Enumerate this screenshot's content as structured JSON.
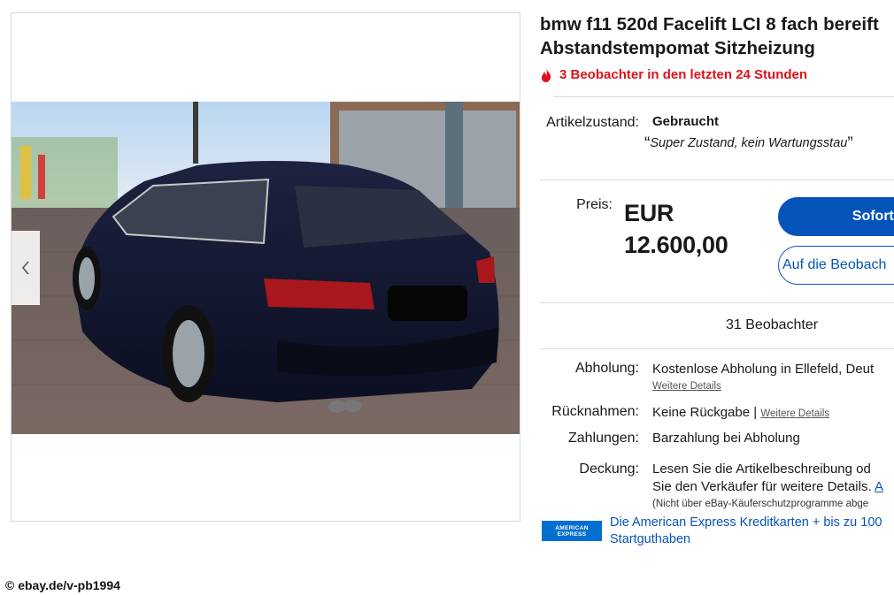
{
  "listing": {
    "title": "bmw f11 520d Facelift LCI 8 fach bereift Abstandstempomat Sitzheizung",
    "hot_watchers": "3 Beobachter in den letzten 24 Stunden",
    "condition_label": "Artikelzustand:",
    "condition_value": "Gebraucht",
    "condition_note": "Super Zustand, kein Wartungsstau",
    "price_label": "Preis:",
    "price_currency": "EUR",
    "price_amount": "12.600,00",
    "buy_button": "Sofort-",
    "watch_button": "Auf die Beobach",
    "watchers_count": "31 Beobachter",
    "pickup_label": "Abholung:",
    "pickup_value": "Kostenlose Abholung in Ellefeld, Deut",
    "pickup_link": "Weitere Details",
    "returns_label": "Rücknahmen:",
    "returns_value": "Keine Rückgabe |",
    "returns_link": "Weitere Details",
    "payment_label": "Zahlungen:",
    "payment_value": "Barzahlung bei Abholung",
    "coverage_label": "Deckung:",
    "coverage_line1": "Lesen Sie die Artikelbeschreibung od",
    "coverage_line2": "Sie den Verkäufer für weitere Details.",
    "coverage_link": "A",
    "coverage_note": "(Nicht über eBay-Käuferschutzprogramme abge",
    "amex_logo_text": "AMERICAN EXPRESS",
    "amex_promo": "Die American Express Kreditkarten + bis zu 100 Startguthaben"
  },
  "footer": {
    "copyright": "© ebay.de/v-pb1994"
  },
  "icons": {
    "flame": "flame-icon",
    "prev": "chevron-left-icon",
    "next": "chevron-right-icon"
  },
  "colors": {
    "brand_blue": "#0654ba",
    "hot_red": "#e0101b",
    "amex_blue": "#016fd0"
  }
}
